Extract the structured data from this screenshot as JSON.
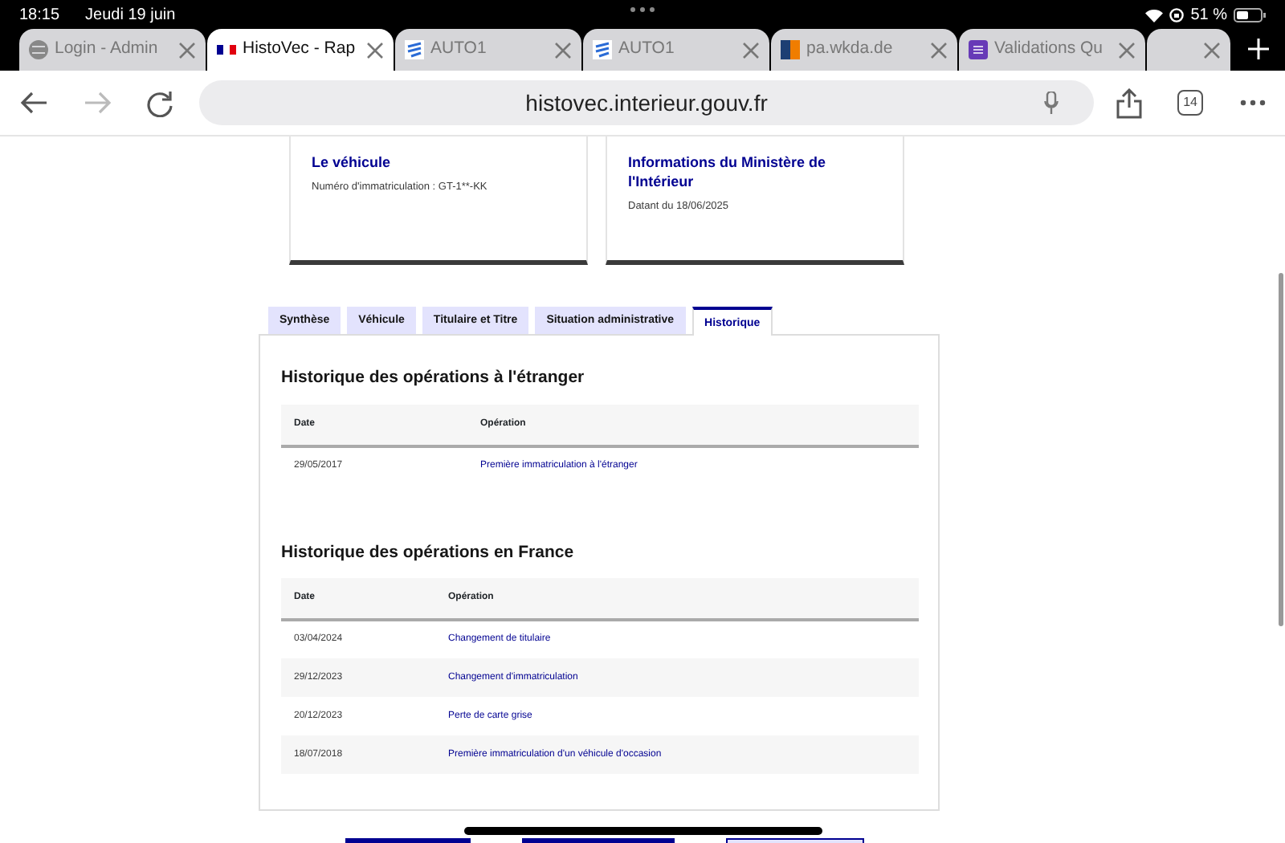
{
  "status_bar": {
    "time": "18:15",
    "date": "Jeudi 19 juin",
    "battery": "51 %"
  },
  "browser_tabs": [
    {
      "title": "Login - Admin",
      "kind": "globe",
      "selected": false
    },
    {
      "title": "HistoVec - Rap",
      "kind": "flag",
      "selected": true
    },
    {
      "title": "AUTO1",
      "kind": "auto",
      "selected": false
    },
    {
      "title": "AUTO1",
      "kind": "auto",
      "selected": false
    },
    {
      "title": "pa.wkda.de",
      "kind": "square",
      "selected": false
    },
    {
      "title": "Validations Qu",
      "kind": "form",
      "selected": false
    }
  ],
  "toolbar": {
    "url": "histovec.interieur.gouv.fr",
    "tab_count": "14",
    "forward_disabled": true
  },
  "cards": [
    {
      "title": "Le véhicule",
      "text": "Numéro d'immatriculation : GT-1**-KK"
    },
    {
      "title": "Informations du Ministère de l'Intérieur",
      "text": "Datant du 18/06/2025"
    }
  ],
  "page_tabs": [
    {
      "label": "Synthèse",
      "selected": false
    },
    {
      "label": "Véhicule",
      "selected": false
    },
    {
      "label": "Titulaire et Titre",
      "selected": false
    },
    {
      "label": "Situation administrative",
      "selected": false
    },
    {
      "label": "Historique",
      "selected": true
    }
  ],
  "sections": [
    {
      "title": "Historique des opérations à l'étranger",
      "columns": [
        "Date",
        "Opération"
      ],
      "rows": [
        {
          "date": "29/05/2017",
          "operation": "Première immatriculation à l'étranger"
        }
      ]
    },
    {
      "title": "Historique des opérations en France",
      "columns": [
        "Date",
        "Opération"
      ],
      "rows": [
        {
          "date": "03/04/2024",
          "operation": "Changement de titulaire"
        },
        {
          "date": "29/12/2023",
          "operation": "Changement d'immatriculation"
        },
        {
          "date": "20/12/2023",
          "operation": "Perte de carte grise"
        },
        {
          "date": "18/07/2018",
          "operation": "Première immatriculation d'un véhicule d'occasion"
        }
      ]
    }
  ]
}
